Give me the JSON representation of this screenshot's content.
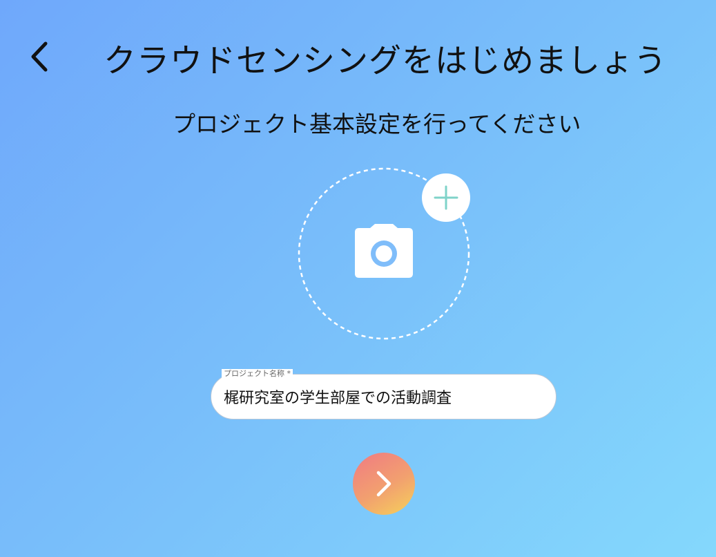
{
  "header": {
    "title": "クラウドセンシングをはじめましょう",
    "subtitle": "プロジェクト基本設定を行ってください"
  },
  "icons": {
    "back": "chevron-left-icon",
    "camera": "camera-icon",
    "add": "plus-icon",
    "next": "chevron-right-icon"
  },
  "project_name_field": {
    "label": "プロジェクト名称 *",
    "value": "梶研究室の学生部屋での活動調査"
  },
  "colors": {
    "background_start": "#6fa8fb",
    "background_end": "#84d8fc",
    "plus_accent": "#7fd3c9",
    "next_button_start": "#f07a83",
    "next_button_end": "#f5d25a"
  }
}
